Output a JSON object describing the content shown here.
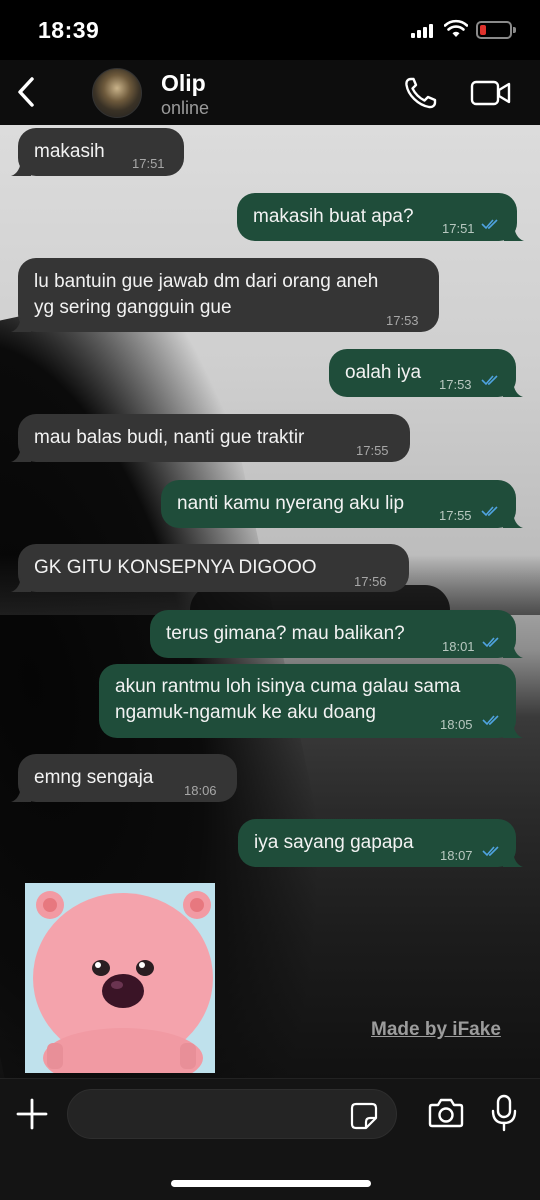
{
  "status_bar": {
    "time": "18:39"
  },
  "header": {
    "contact_name": "Olip",
    "contact_status": "online"
  },
  "messages": [
    {
      "dir": "in",
      "text": "makasih",
      "time": "17:51"
    },
    {
      "dir": "out",
      "text": "makasih buat apa?",
      "time": "17:51"
    },
    {
      "dir": "in",
      "text": "lu bantuin gue jawab dm dari orang aneh\nyg sering gangguin gue",
      "time": "17:53"
    },
    {
      "dir": "out",
      "text": "oalah iya",
      "time": "17:53"
    },
    {
      "dir": "in",
      "text": "mau balas budi, nanti gue traktir",
      "time": "17:55"
    },
    {
      "dir": "out",
      "text": "nanti kamu nyerang aku lip",
      "time": "17:55"
    },
    {
      "dir": "in",
      "text": "GK GITU KONSEPNYA DIGOOO",
      "time": "17:56"
    },
    {
      "dir": "out",
      "text": "terus gimana? mau balikan?",
      "time": "18:01"
    },
    {
      "dir": "out",
      "text": "akun rantmu loh isinya cuma galau sama\nngamuk-ngamuk ke aku doang",
      "time": "18:05"
    },
    {
      "dir": "in",
      "text": "emng sengaja",
      "time": "18:06"
    },
    {
      "dir": "out",
      "text": "iya sayang gapapa",
      "time": "18:07"
    }
  ],
  "watermark": "Made by iFake",
  "colors": {
    "incoming": "#353535",
    "outgoing": "#1f4d3a",
    "read_ticks": "#4fa3e0"
  }
}
